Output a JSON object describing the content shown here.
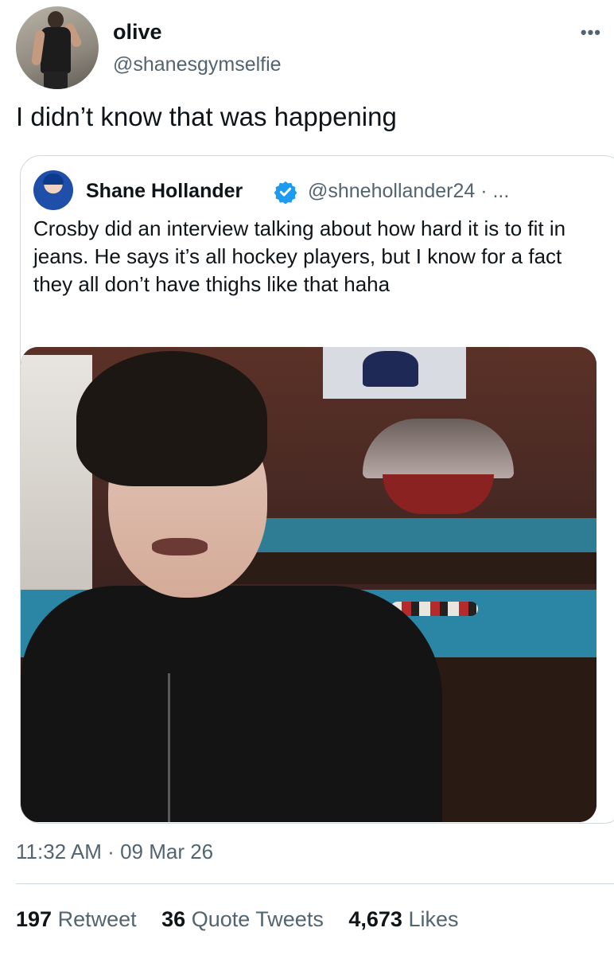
{
  "author": {
    "name": "olive",
    "handle": "@shanesgymselfie",
    "more_icon": "•••"
  },
  "tweet": {
    "text": "I didn’t know that was happening"
  },
  "quoted_tweet": {
    "name": "Shane Hollander",
    "handle_meta": "@shnehollander24 · ...",
    "text": "Crosby did an interview talking about how hard it is to fit in jeans. He says it’s all hockey players, but I know for a fact they all don’t have thighs like that haha",
    "verified_color": "#1d9bf0"
  },
  "meta": {
    "time": "11:32 AM",
    "separator": "·",
    "date": "09 Mar 26"
  },
  "stats": {
    "retweets_count": "197",
    "retweets_label": "Retweet",
    "quotes_count": "36",
    "quotes_label": "Quote Tweets",
    "likes_count": "4,673",
    "likes_label": "Likes"
  },
  "colors": {
    "text_primary": "#0f1419",
    "text_secondary": "#536471",
    "border": "#cfd9de"
  }
}
